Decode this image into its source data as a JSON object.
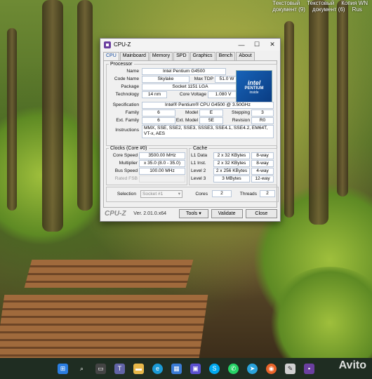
{
  "desktop": {
    "top_right_labels": [
      "Текстовый",
      "Текстовый",
      "Копия WN"
    ],
    "top_right_labels_2": [
      "документ (9)",
      "документ (6)",
      "Rus"
    ]
  },
  "window": {
    "title": "CPU-Z",
    "controls": [
      "—",
      "☐",
      "✕"
    ],
    "tabs": [
      "CPU",
      "Mainboard",
      "Memory",
      "SPD",
      "Graphics",
      "Bench",
      "About"
    ],
    "active_tab": "CPU"
  },
  "processor": {
    "legend": "Processor",
    "name_label": "Name",
    "name": "Intel Pentium G4500",
    "codename_label": "Code Name",
    "codename": "Skylake",
    "maxtdp_label": "Max TDP",
    "maxtdp": "51.0 W",
    "package_label": "Package",
    "package": "Socket 1151 LGA",
    "technology_label": "Technology",
    "technology": "14 nm",
    "corevoltage_label": "Core Voltage",
    "corevoltage": "1.080 V",
    "spec_label": "Specification",
    "spec": "Intel® Pentium® CPU G4500 @ 3.50GHz",
    "family_label": "Family",
    "family": "6",
    "model_label": "Model",
    "model": "E",
    "stepping_label": "Stepping",
    "stepping": "3",
    "extfamily_label": "Ext. Family",
    "extfamily": "6",
    "extmodel_label": "Ext. Model",
    "extmodel": "5E",
    "revision_label": "Revision",
    "revision": "R0",
    "instructions_label": "Instructions",
    "instructions": "MMX, SSE, SSE2, SSE3, SSSE3, SSE4.1, SSE4.2, EM64T, VT-x, AES",
    "logo": {
      "brand": "intel",
      "product": "PENTIUM",
      "sub": "inside"
    }
  },
  "clocks": {
    "legend": "Clocks (Core #0)",
    "corespeed_label": "Core Speed",
    "corespeed": "3500.00 MHz",
    "multiplier_label": "Multiplier",
    "multiplier": "x 35.0 (8.0 - 35.0)",
    "busspeed_label": "Bus Speed",
    "busspeed": "100.00 MHz",
    "ratedfsb_label": "Rated FSB",
    "ratedfsb": ""
  },
  "cache": {
    "legend": "Cache",
    "rows": [
      {
        "label": "L1 Data",
        "size": "2 x 32 KBytes",
        "way": "8-way"
      },
      {
        "label": "L1 Inst.",
        "size": "2 x 32 KBytes",
        "way": "8-way"
      },
      {
        "label": "Level 2",
        "size": "2 x 256 KBytes",
        "way": "4-way"
      },
      {
        "label": "Level 3",
        "size": "3 MBytes",
        "way": "12-way"
      }
    ]
  },
  "selection": {
    "selection_label": "Selection",
    "socket": "Socket #1",
    "cores_label": "Cores",
    "cores": "2",
    "threads_label": "Threads",
    "threads": "2"
  },
  "footer": {
    "brand": "CPU-Z",
    "version": "Ver. 2.01.0.x64",
    "tools": "Tools",
    "validate": "Validate",
    "close": "Close"
  },
  "taskbar": {
    "icons": [
      "windows-start-icon",
      "search-icon",
      "task-view-icon",
      "teams-icon",
      "file-explorer-icon",
      "edge-icon",
      "store-icon",
      "save-icon",
      "skype-icon",
      "whatsapp-icon",
      "telegram-icon",
      "firefox-icon",
      "paint-icon",
      "cpuz-icon"
    ],
    "watermark": "Avito"
  },
  "colors": {
    "accent": "#1a4fa0",
    "taskbar": "#1f2d22"
  }
}
